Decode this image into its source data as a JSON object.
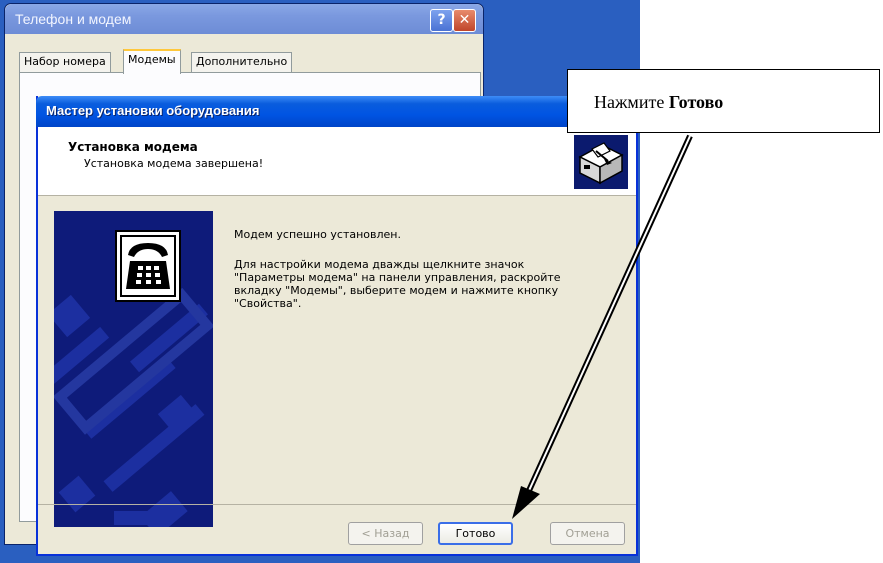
{
  "background_window": {
    "title": "Телефон и модем",
    "tabs": [
      "Набор номера",
      "Модемы",
      "Дополнительно"
    ],
    "help_label": "?",
    "close_label": "✕"
  },
  "wizard": {
    "title": "Мастер установки оборудования",
    "header_title": "Установка модема",
    "header_subtitle": "Установка модема завершена!",
    "body": [
      "Модем успешно установлен.",
      "Для настройки модема дважды щелкните значок \"Параметры модема\" на панели управления, раскройте вкладку \"Модемы\", выберите модем и нажмите кнопку \"Свойства\"."
    ],
    "buttons": {
      "back": "< Назад",
      "finish": "Готово",
      "cancel": "Отмена"
    },
    "header_icon": "modem-setup-icon",
    "side_icon": "telephone-icon"
  },
  "callout": {
    "text_prefix": "Нажмите ",
    "text_bold": "Готово"
  },
  "colors": {
    "desktop": "#2a5fc0",
    "wizard_title_bar": "#0054e3",
    "window_face": "#ece9d8"
  }
}
